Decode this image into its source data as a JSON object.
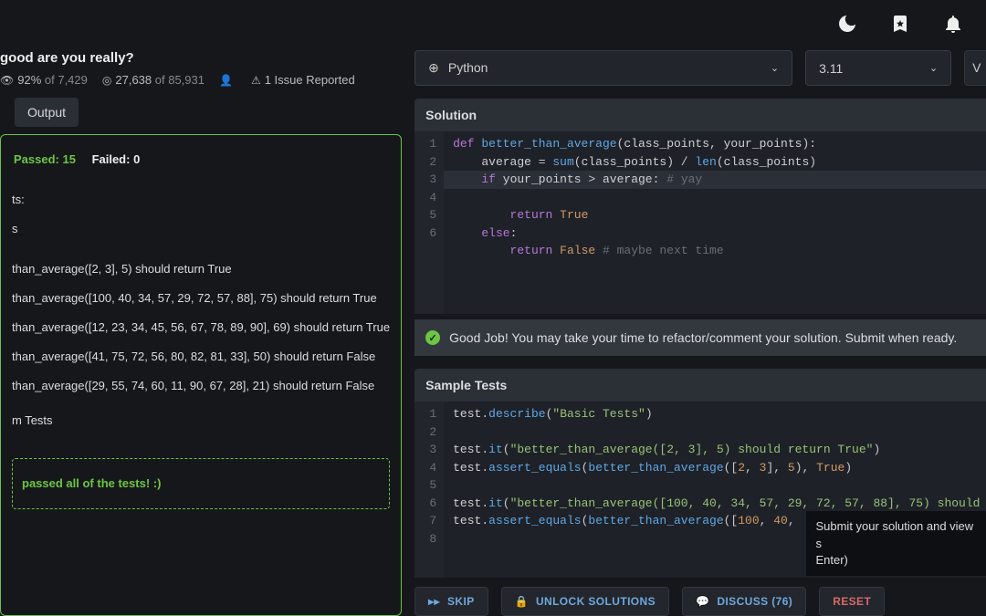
{
  "header": {
    "title": "good are you really?"
  },
  "stats": {
    "satisfaction_pct": "92%",
    "satisfaction_of": "of 7,429",
    "completed": "27,638",
    "completed_of": "of 85,931",
    "issue": "1 Issue Reported"
  },
  "output_btn": "Output",
  "results": {
    "passed_label": "Passed: 15",
    "failed_label": "Failed: 0",
    "tests_header": "ts:",
    "tests_sub": "s",
    "lines": [
      "than_average([2, 3], 5) should return True",
      "than_average([100, 40, 34, 57, 29, 72, 57, 88], 75) should return True",
      "than_average([12, 23, 34, 45, 56, 67, 78, 89, 90], 69) should return True",
      "than_average([41, 75, 72, 56, 80, 82, 81, 33], 50) should return False",
      "than_average([29, 55, 74, 60, 11, 90, 67, 28], 21) should return False"
    ],
    "more_tests": "m Tests",
    "success": "passed all of the tests! :)"
  },
  "selectors": {
    "language": "Python",
    "version": "3.11",
    "vim": "V"
  },
  "solution": {
    "header": "Solution",
    "gutter": [
      "1",
      "2",
      "3",
      "4",
      "5",
      "6"
    ]
  },
  "status": "Good Job! You may take your time to refactor/comment your solution. Submit when ready.",
  "tests": {
    "header": "Sample Tests",
    "gutter": [
      "1",
      "2",
      "3",
      "4",
      "5",
      "6",
      "7",
      "8"
    ]
  },
  "tooltip": {
    "line1": "Submit your solution and view s",
    "line2": "Enter)"
  },
  "actions": {
    "skip": "SKIP",
    "unlock": "UNLOCK SOLUTIONS",
    "discuss": "DISCUSS (76)",
    "reset": "RESET"
  }
}
